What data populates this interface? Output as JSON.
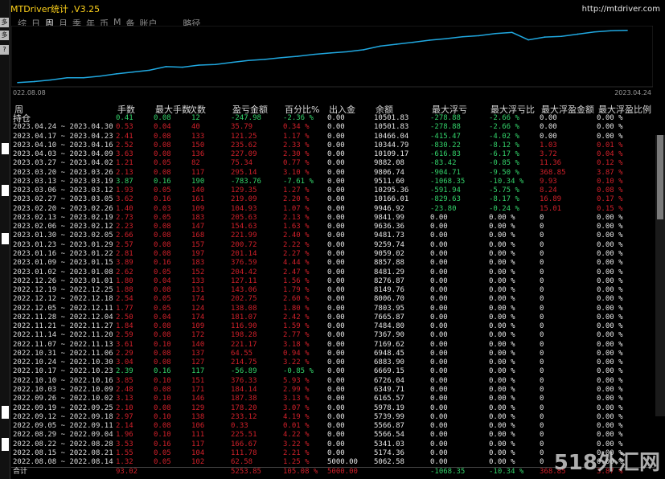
{
  "window": {
    "title": "MTDriver统计 ,V3.25",
    "url": "http://mtdriver.com"
  },
  "gutter": {
    "buttons": [
      "多",
      "多",
      "?"
    ]
  },
  "tabs": [
    {
      "label": "综",
      "active": false
    },
    {
      "label": "日",
      "active": false
    },
    {
      "label": "周",
      "active": true
    },
    {
      "label": "月",
      "active": false
    },
    {
      "label": "季",
      "active": false
    },
    {
      "label": "年",
      "active": false
    },
    {
      "label": "币",
      "active": false
    },
    {
      "label": "M",
      "active": false
    },
    {
      "label": "备",
      "active": false
    },
    {
      "label": "账户",
      "active": false
    },
    {
      "label": "略径",
      "active": false,
      "range": true
    }
  ],
  "chart_data": {
    "type": "line",
    "x_start": "022.08.08",
    "x_end": "2023.04.24",
    "series": [
      {
        "color": "#20a8e0",
        "values": [
          5062.58,
          5174.36,
          5341.03,
          5566.54,
          5566.87,
          5739.99,
          5978.19,
          6165.57,
          6349.71,
          6726.04,
          6669.15,
          6883.9,
          6948.45,
          7169.62,
          7367.9,
          7484.8,
          7665.87,
          7803.95,
          8006.7,
          8149.76,
          8276.87,
          8481.29,
          8857.88,
          9059.02,
          9259.74,
          9481.73,
          9636.36,
          9841.99,
          9946.92,
          10166.01,
          10295.36,
          9511.6,
          9806.74,
          9882.08,
          10109.17,
          10344.79,
          10466.04,
          10501.83
        ]
      }
    ]
  },
  "table": {
    "headers": [
      "周",
      "手数",
      "最大手数",
      "次数",
      "盈亏金额",
      "百分比%",
      "出入金",
      "余额",
      "最大浮亏",
      "最大浮亏比",
      "最大浮盈金额",
      "最大浮盈比例"
    ],
    "hold": {
      "label": "持仓",
      "cells": [
        "0.41",
        "0.08",
        "12",
        "-247.98",
        "-2.36 %",
        "0.00",
        "10501.83",
        "-278.88",
        "-2.66 %",
        "0.00",
        "0.00 %"
      ],
      "colors": [
        "g",
        "g",
        "g",
        "g",
        "g",
        "w",
        "w",
        "g",
        "g",
        "w",
        "w"
      ]
    },
    "rows": [
      [
        "2023.04.24 ~ 2023.04.30",
        "0.53",
        "0.04",
        "40",
        "35.79",
        "0.34 %",
        "0.00",
        "10501.83",
        "-278.88",
        "-2.66 %",
        "0.00",
        "0.00 %"
      ],
      [
        "2023.04.17 ~ 2023.04.23",
        "2.41",
        "0.08",
        "133",
        "121.25",
        "1.17 %",
        "0.00",
        "10466.04",
        "-415.47",
        "-4.02 %",
        "0.00",
        "0.00 %"
      ],
      [
        "2023.04.10 ~ 2023.04.16",
        "2.52",
        "0.08",
        "150",
        "235.62",
        "2.33 %",
        "0.00",
        "10344.79",
        "-830.22",
        "-8.12 %",
        "1.03",
        "0.01 %"
      ],
      [
        "2023.04.03 ~ 2023.04.09",
        "3.63",
        "0.08",
        "136",
        "227.09",
        "2.30 %",
        "0.00",
        "10109.17",
        "-616.83",
        "-6.17 %",
        "3.72",
        "0.04 %"
      ],
      [
        "2023.03.27 ~ 2023.04.02",
        "1.21",
        "0.05",
        "82",
        "75.34",
        "0.77 %",
        "0.00",
        "9882.08",
        "-83.42",
        "-0.85 %",
        "11.36",
        "0.12 %"
      ],
      [
        "2023.03.20 ~ 2023.03.26",
        "2.13",
        "0.08",
        "117",
        "295.14",
        "3.10 %",
        "0.00",
        "9806.74",
        "-904.71",
        "-9.50 %",
        "368.85",
        "3.87 %"
      ],
      [
        "2023.03.13 ~ 2023.03.19",
        "3.87",
        "0.16",
        "190",
        "-783.76",
        "-7.61 %",
        "0.00",
        "9511.60",
        "-1068.35",
        "-10.34 %",
        "9.93",
        "0.10 %"
      ],
      [
        "2023.03.06 ~ 2023.03.12",
        "1.93",
        "0.05",
        "140",
        "129.35",
        "1.27 %",
        "0.00",
        "10295.36",
        "-591.94",
        "-5.75 %",
        "8.24",
        "0.08 %"
      ],
      [
        "2023.02.27 ~ 2023.03.05",
        "3.62",
        "0.16",
        "161",
        "219.09",
        "2.20 %",
        "0.00",
        "10166.01",
        "-829.63",
        "-8.17 %",
        "16.89",
        "0.17 %"
      ],
      [
        "2023.02.20 ~ 2023.02.26",
        "1.40",
        "0.03",
        "109",
        "104.93",
        "1.07 %",
        "0.00",
        "9946.92",
        "-23.80",
        "-0.24 %",
        "15.01",
        "0.15 %"
      ],
      [
        "2023.02.13 ~ 2023.02.19",
        "2.73",
        "0.05",
        "183",
        "205.63",
        "2.13 %",
        "0.00",
        "9841.99",
        "0.00",
        "0.00 %",
        "0",
        "0.00 %"
      ],
      [
        "2023.02.06 ~ 2023.02.12",
        "2.23",
        "0.08",
        "147",
        "154.63",
        "1.63 %",
        "0.00",
        "9636.36",
        "0.00",
        "0.00 %",
        "0",
        "0.00 %"
      ],
      [
        "2023.01.30 ~ 2023.02.05",
        "2.66",
        "0.08",
        "168",
        "221.99",
        "2.40 %",
        "0.00",
        "9481.73",
        "0.00",
        "0.00 %",
        "0",
        "0.00 %"
      ],
      [
        "2023.01.23 ~ 2023.01.29",
        "2.57",
        "0.08",
        "157",
        "200.72",
        "2.22 %",
        "0.00",
        "9259.74",
        "0.00",
        "0.00 %",
        "0",
        "0.00 %"
      ],
      [
        "2023.01.16 ~ 2023.01.22",
        "2.81",
        "0.08",
        "197",
        "201.14",
        "2.27 %",
        "0.00",
        "9059.02",
        "0.00",
        "0.00 %",
        "0",
        "0.00 %"
      ],
      [
        "2023.01.09 ~ 2023.01.15",
        "3.89",
        "0.16",
        "183",
        "376.59",
        "4.44 %",
        "0.00",
        "8857.88",
        "0.00",
        "0.00 %",
        "0",
        "0.00 %"
      ],
      [
        "2023.01.02 ~ 2023.01.08",
        "2.62",
        "0.05",
        "152",
        "204.42",
        "2.47 %",
        "0.00",
        "8481.29",
        "0.00",
        "0.00 %",
        "0",
        "0.00 %"
      ],
      [
        "2022.12.26 ~ 2023.01.01",
        "1.80",
        "0.04",
        "133",
        "127.11",
        "1.56 %",
        "0.00",
        "8276.87",
        "0.00",
        "0.00 %",
        "0",
        "0.00 %"
      ],
      [
        "2022.12.19 ~ 2022.12.25",
        "1.88",
        "0.08",
        "131",
        "143.06",
        "1.79 %",
        "0.00",
        "8149.76",
        "0.00",
        "0.00 %",
        "0",
        "0.00 %"
      ],
      [
        "2022.12.12 ~ 2022.12.18",
        "2.54",
        "0.05",
        "174",
        "202.75",
        "2.60 %",
        "0.00",
        "8006.70",
        "0.00",
        "0.00 %",
        "0",
        "0.00 %"
      ],
      [
        "2022.12.05 ~ 2022.12.11",
        "1.77",
        "0.05",
        "124",
        "138.08",
        "1.80 %",
        "0.00",
        "7803.95",
        "0.00",
        "0.00 %",
        "0",
        "0.00 %"
      ],
      [
        "2022.11.28 ~ 2022.12.04",
        "2.50",
        "0.04",
        "174",
        "181.07",
        "2.42 %",
        "0.00",
        "7665.87",
        "0.00",
        "0.00 %",
        "0",
        "0.00 %"
      ],
      [
        "2022.11.21 ~ 2022.11.27",
        "1.84",
        "0.08",
        "109",
        "116.90",
        "1.59 %",
        "0.00",
        "7484.80",
        "0.00",
        "0.00 %",
        "0",
        "0.00 %"
      ],
      [
        "2022.11.14 ~ 2022.11.20",
        "2.59",
        "0.08",
        "172",
        "198.28",
        "2.77 %",
        "0.00",
        "7367.90",
        "0.00",
        "0.00 %",
        "0",
        "0.00 %"
      ],
      [
        "2022.11.07 ~ 2022.11.13",
        "3.61",
        "0.10",
        "140",
        "221.17",
        "3.18 %",
        "0.00",
        "7169.62",
        "0.00",
        "0.00 %",
        "0",
        "0.00 %"
      ],
      [
        "2022.10.31 ~ 2022.11.06",
        "2.29",
        "0.08",
        "137",
        "64.55",
        "0.94 %",
        "0.00",
        "6948.45",
        "0.00",
        "0.00 %",
        "0",
        "0.00 %"
      ],
      [
        "2022.10.24 ~ 2022.10.30",
        "3.04",
        "0.08",
        "127",
        "214.75",
        "3.22 %",
        "0.00",
        "6883.90",
        "0.00",
        "0.00 %",
        "0",
        "0.00 %"
      ],
      [
        "2022.10.17 ~ 2022.10.23",
        "2.39",
        "0.16",
        "117",
        "-56.89",
        "-0.85 %",
        "0.00",
        "6669.15",
        "0.00",
        "0.00 %",
        "0",
        "0.00 %"
      ],
      [
        "2022.10.10 ~ 2022.10.16",
        "3.85",
        "0.10",
        "151",
        "376.33",
        "5.93 %",
        "0.00",
        "6726.04",
        "0.00",
        "0.00 %",
        "0",
        "0.00 %"
      ],
      [
        "2022.10.03 ~ 2022.10.09",
        "2.48",
        "0.08",
        "171",
        "184.14",
        "2.99 %",
        "0.00",
        "6349.71",
        "0.00",
        "0.00 %",
        "0",
        "0.00 %"
      ],
      [
        "2022.09.26 ~ 2022.10.02",
        "3.13",
        "0.10",
        "146",
        "187.38",
        "3.13 %",
        "0.00",
        "6165.57",
        "0.00",
        "0.00 %",
        "0",
        "0.00 %"
      ],
      [
        "2022.09.19 ~ 2022.09.25",
        "2.10",
        "0.08",
        "129",
        "178.20",
        "3.07 %",
        "0.00",
        "5978.19",
        "0.00",
        "0.00 %",
        "0",
        "0.00 %"
      ],
      [
        "2022.09.12 ~ 2022.09.18",
        "2.97",
        "0.10",
        "138",
        "233.12",
        "4.19 %",
        "0.00",
        "5739.99",
        "0.00",
        "0.00 %",
        "0",
        "0.00 %"
      ],
      [
        "2022.09.05 ~ 2022.09.11",
        "2.14",
        "0.08",
        "106",
        "0.33",
        "0.01 %",
        "0.00",
        "5566.87",
        "0.00",
        "0.00 %",
        "0",
        "0.00 %"
      ],
      [
        "2022.08.29 ~ 2022.09.04",
        "1.96",
        "0.10",
        "111",
        "225.51",
        "4.22 %",
        "0.00",
        "5566.54",
        "0.00",
        "0.00 %",
        "0",
        "0.00 %"
      ],
      [
        "2022.08.22 ~ 2022.08.28",
        "3.53",
        "0.16",
        "117",
        "166.67",
        "3.22 %",
        "0.00",
        "5341.03",
        "0.00",
        "0.00 %",
        "0",
        "0.00 %"
      ],
      [
        "2022.08.15 ~ 2022.08.21",
        "1.55",
        "0.05",
        "104",
        "111.78",
        "2.21 %",
        "0.00",
        "5174.36",
        "0.00",
        "0.00 %",
        "0",
        "0.00 %"
      ],
      [
        "2022.08.08 ~ 2022.08.14",
        "1.32",
        "0.05",
        "102",
        "62.58",
        "1.25 %",
        "5000.00",
        "5062.58",
        "0.00",
        "0.00 %",
        "0",
        "0.00 %"
      ]
    ],
    "total": {
      "label": "合计",
      "cells": [
        "93.02",
        "",
        "",
        "5253.85",
        "105.08 %",
        "5000.00",
        "",
        "-1068.35",
        "-10.34 %",
        "368.85",
        "3.87 %"
      ]
    }
  },
  "watermark": "518外汇网"
}
